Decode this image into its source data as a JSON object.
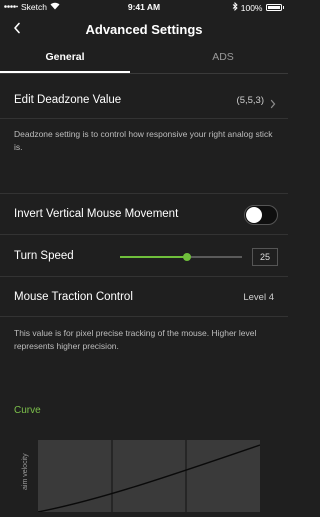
{
  "status_bar": {
    "carrier": "Sketch",
    "time": "9:41 AM",
    "battery": "100%"
  },
  "nav": {
    "title": "Advanced Settings",
    "back_icon": "chevron-left-icon"
  },
  "tabs": [
    {
      "label": "General",
      "active": true
    },
    {
      "label": "ADS",
      "active": false
    }
  ],
  "deadzone": {
    "label": "Edit Deadzone Value",
    "value": "(5,5,3)",
    "description": "Deadzone setting is to control how responsive your right analog stick is."
  },
  "invert_vertical": {
    "label": "Invert Vertical Mouse Movement",
    "enabled": false
  },
  "turn_speed": {
    "label": "Turn Speed",
    "value": "25",
    "slider_fraction": 0.55
  },
  "mouse_traction": {
    "label": "Mouse Traction Control",
    "value": "Level 4",
    "description": "This value is for pixel precise tracking of the mouse. Higher level represents higher precision."
  },
  "curve": {
    "title": "Curve",
    "y_axis_label": "aim velocity"
  },
  "colors": {
    "accent": "#6fbf3b",
    "background": "#1f1f1f",
    "graph_bg": "#3a3a3a"
  }
}
